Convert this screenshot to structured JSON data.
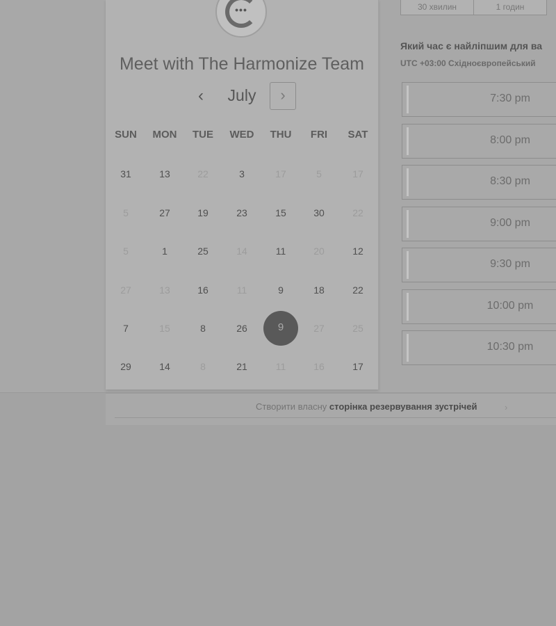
{
  "header": {
    "title": "Meet with The Harmonize Team",
    "avatar_icon": "harmonize-logo-icon"
  },
  "calendar": {
    "month": "July",
    "prev_label": "‹",
    "next_label": "›",
    "weekdays": [
      "SUN",
      "MON",
      "TUE",
      "WED",
      "THU",
      "FRI",
      "SAT"
    ],
    "selected": "9",
    "rows": [
      [
        {
          "d": "31",
          "a": true
        },
        {
          "d": "13",
          "a": true
        },
        {
          "d": "22",
          "a": false
        },
        {
          "d": "3",
          "a": true
        },
        {
          "d": "17",
          "a": false
        },
        {
          "d": "5",
          "a": false
        },
        {
          "d": "17",
          "a": false
        }
      ],
      [
        {
          "d": "5",
          "a": false
        },
        {
          "d": "27",
          "a": true
        },
        {
          "d": "19",
          "a": true
        },
        {
          "d": "23",
          "a": true
        },
        {
          "d": "15",
          "a": true
        },
        {
          "d": "30",
          "a": true
        },
        {
          "d": "22",
          "a": false
        }
      ],
      [
        {
          "d": "5",
          "a": false
        },
        {
          "d": "1",
          "a": true
        },
        {
          "d": "25",
          "a": true
        },
        {
          "d": "14",
          "a": false
        },
        {
          "d": "11",
          "a": true
        },
        {
          "d": "20",
          "a": false
        },
        {
          "d": "12",
          "a": true
        }
      ],
      [
        {
          "d": "27",
          "a": false
        },
        {
          "d": "13",
          "a": false
        },
        {
          "d": "16",
          "a": true
        },
        {
          "d": "11",
          "a": false
        },
        {
          "d": "9",
          "a": true
        },
        {
          "d": "18",
          "a": true
        },
        {
          "d": "22",
          "a": true
        }
      ],
      [
        {
          "d": "7",
          "a": true
        },
        {
          "d": "15",
          "a": false
        },
        {
          "d": "8",
          "a": true
        },
        {
          "d": "26",
          "a": true
        },
        {
          "d": "9",
          "a": true,
          "sel": true
        },
        {
          "d": "27",
          "a": false
        },
        {
          "d": "25",
          "a": false
        }
      ],
      [
        {
          "d": "29",
          "a": true
        },
        {
          "d": "14",
          "a": true
        },
        {
          "d": "8",
          "a": false
        },
        {
          "d": "21",
          "a": true
        },
        {
          "d": "11",
          "a": false
        },
        {
          "d": "16",
          "a": false
        },
        {
          "d": "17",
          "a": true
        }
      ]
    ]
  },
  "duration": {
    "options": [
      "30 хвилин",
      "1 годин"
    ]
  },
  "times": {
    "question": "Який час є найліпшим для ва",
    "timezone": "UTC +03:00 Східноєвропейський",
    "slots": [
      "7:30 pm",
      "8:00 pm",
      "8:30 pm",
      "9:00 pm",
      "9:30 pm",
      "10:00 pm",
      "10:30 pm"
    ]
  },
  "footer": {
    "prefix": "Створити власну",
    "link": "сторінка резервування зустрічей"
  },
  "colors": {
    "selected_day_bg": "#595959",
    "background": "#a3a3a3"
  }
}
